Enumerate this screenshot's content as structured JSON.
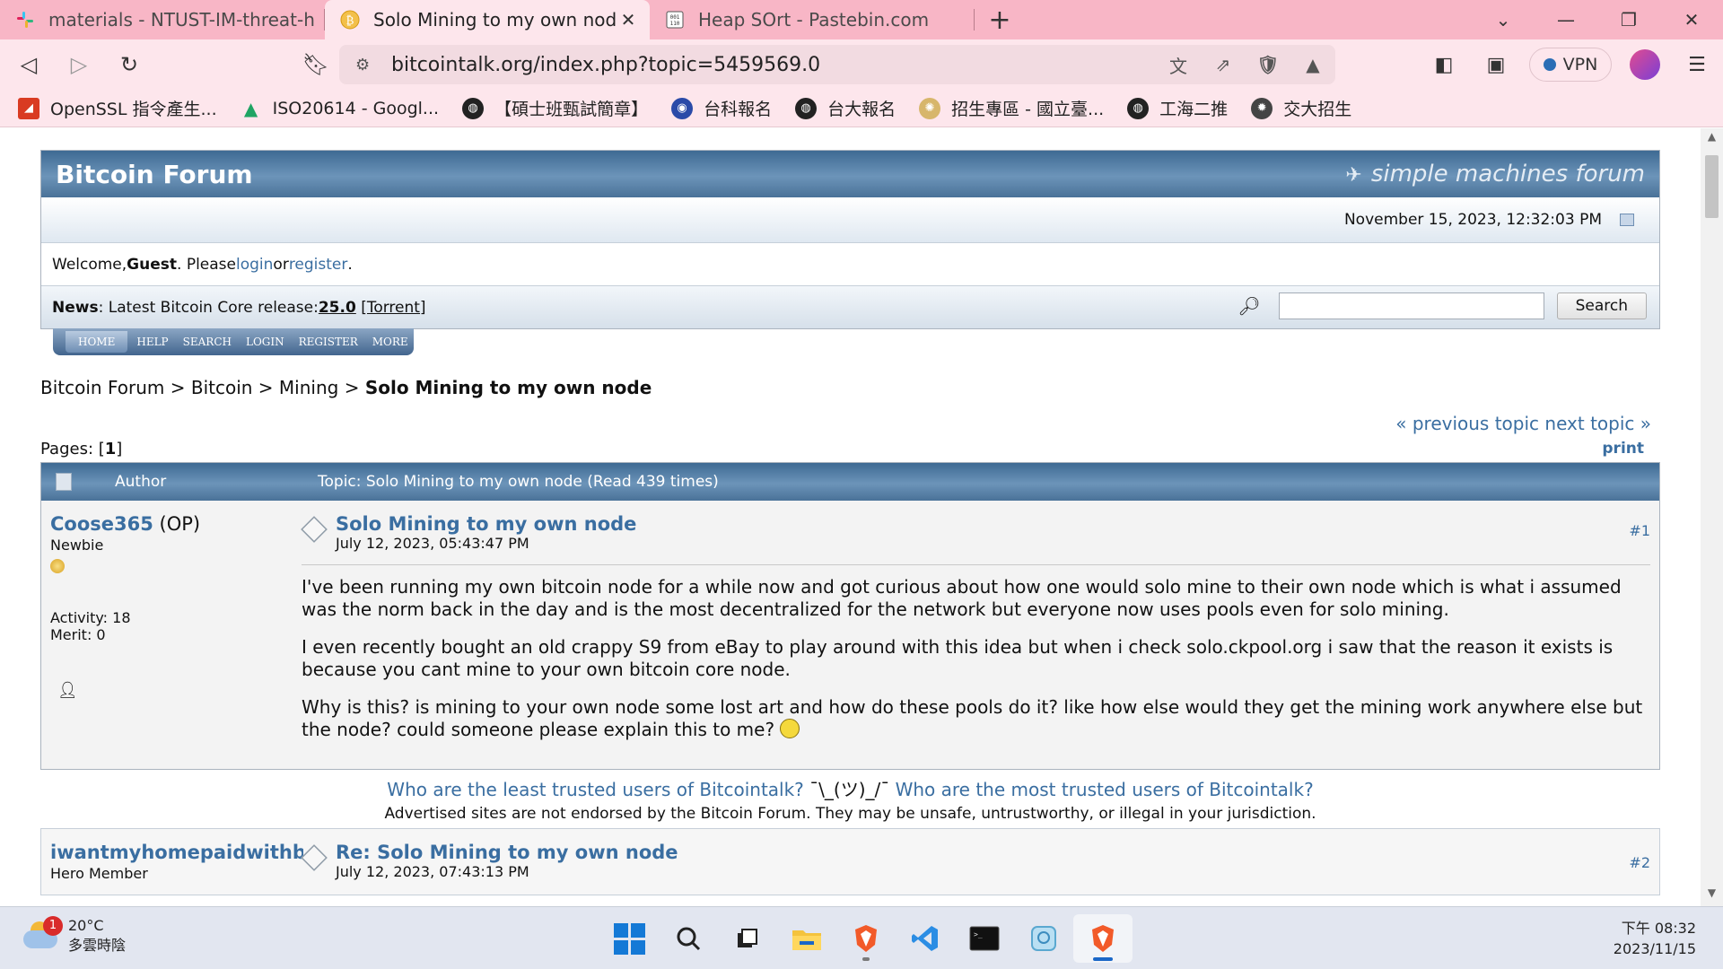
{
  "browser": {
    "tabs": [
      {
        "title": "materials - NTUST-IM-threat-huntin",
        "icon": "slack-icon"
      },
      {
        "title": "Solo Mining to my own node",
        "icon": "bitcoin-icon",
        "active": true
      },
      {
        "title": "Heap SOrt - Pastebin.com",
        "icon": "pastebin-icon"
      }
    ],
    "url": "bitcointalk.org/index.php?topic=5459569.0",
    "vpn_label": "VPN",
    "bookmarks": [
      {
        "label": "OpenSSL 指令產生...",
        "icon": "openssl-icon"
      },
      {
        "label": "ISO20614 - Googl...",
        "icon": "google-drive-icon"
      },
      {
        "label": "【碩士班甄試簡章】",
        "icon": "globe-icon"
      },
      {
        "label": "台科報名",
        "icon": "ntust-icon"
      },
      {
        "label": "台大報名",
        "icon": "globe-icon"
      },
      {
        "label": "招生專區 - 國立臺...",
        "icon": "university-icon"
      },
      {
        "label": "工海二推",
        "icon": "globe-icon"
      },
      {
        "label": "交大招生",
        "icon": "nycu-icon"
      }
    ]
  },
  "forum": {
    "title": "Bitcoin Forum",
    "smf_logo": "simple machines forum",
    "date": "November 15, 2023, 12:32:03 PM",
    "welcome": {
      "prefix": "Welcome, ",
      "guest": "Guest",
      "please": ". Please ",
      "login": "login",
      "or": " or ",
      "register": "register",
      "end": "."
    },
    "news": {
      "label": "News",
      "text": ": Latest Bitcoin Core release: ",
      "version": "25.0",
      "torrent": "[Torrent]"
    },
    "search_button": "Search",
    "menu": [
      "HOME",
      "HELP",
      "SEARCH",
      "LOGIN",
      "REGISTER",
      "MORE"
    ],
    "breadcrumb": {
      "items": [
        "Bitcoin Forum",
        "Bitcoin",
        "Mining"
      ],
      "sep": " > ",
      "current": "Solo Mining to my own node"
    },
    "prev_topic": "« previous topic",
    "next_topic": "next topic »",
    "pages_label": "Pages: [",
    "pages_current": "1",
    "pages_end": "]",
    "print": "print",
    "topic_header": {
      "author": "Author",
      "topic": "Topic: Solo Mining to my own node  (Read 439 times)"
    },
    "posts": [
      {
        "author": "Coose365",
        "op": " (OP)",
        "rank": "Newbie",
        "activity": "Activity: 18",
        "merit": "Merit: 0",
        "subject": "Solo Mining to my own node",
        "date": "July 12, 2023, 05:43:47 PM",
        "number": "#1",
        "paragraphs": [
          "I've been running my own bitcoin node for a while now and got curious about how one would solo mine to their own node which is what i assumed was the norm back in the day and is the most decentralized for the network but everyone now uses pools even for solo mining.",
          "I even recently bought an old crappy S9 from eBay to play around with this idea but when i check solo.ckpool.org i saw that the reason it exists is because you cant mine to your own bitcoin core node.",
          "Why is this? is mining to your own node some lost art and how do these pools do it? like how else would they get the mining work anywhere else but the node? could someone please explain this to me? "
        ]
      },
      {
        "author": "iwantmyhomepaidwithbtc",
        "rank": "Hero Member",
        "subject": "Re: Solo Mining to my own node",
        "date": "July 12, 2023, 07:43:13 PM",
        "number": "#2"
      }
    ],
    "ads": {
      "left": "Who are the least trusted users of Bitcointalk?",
      "shrug": " ¯\\_(ツ)_/¯ ",
      "right": "Who are the most trusted users of Bitcointalk?"
    },
    "disclaimer": "Advertised sites are not endorsed by the Bitcoin Forum. They may be unsafe, untrustworthy, or illegal in your jurisdiction."
  },
  "taskbar": {
    "weather_temp": "20°C",
    "weather_desc": "多雲時陰",
    "weather_badge": "1",
    "time": "下午 08:32",
    "date": "2023/11/15"
  }
}
